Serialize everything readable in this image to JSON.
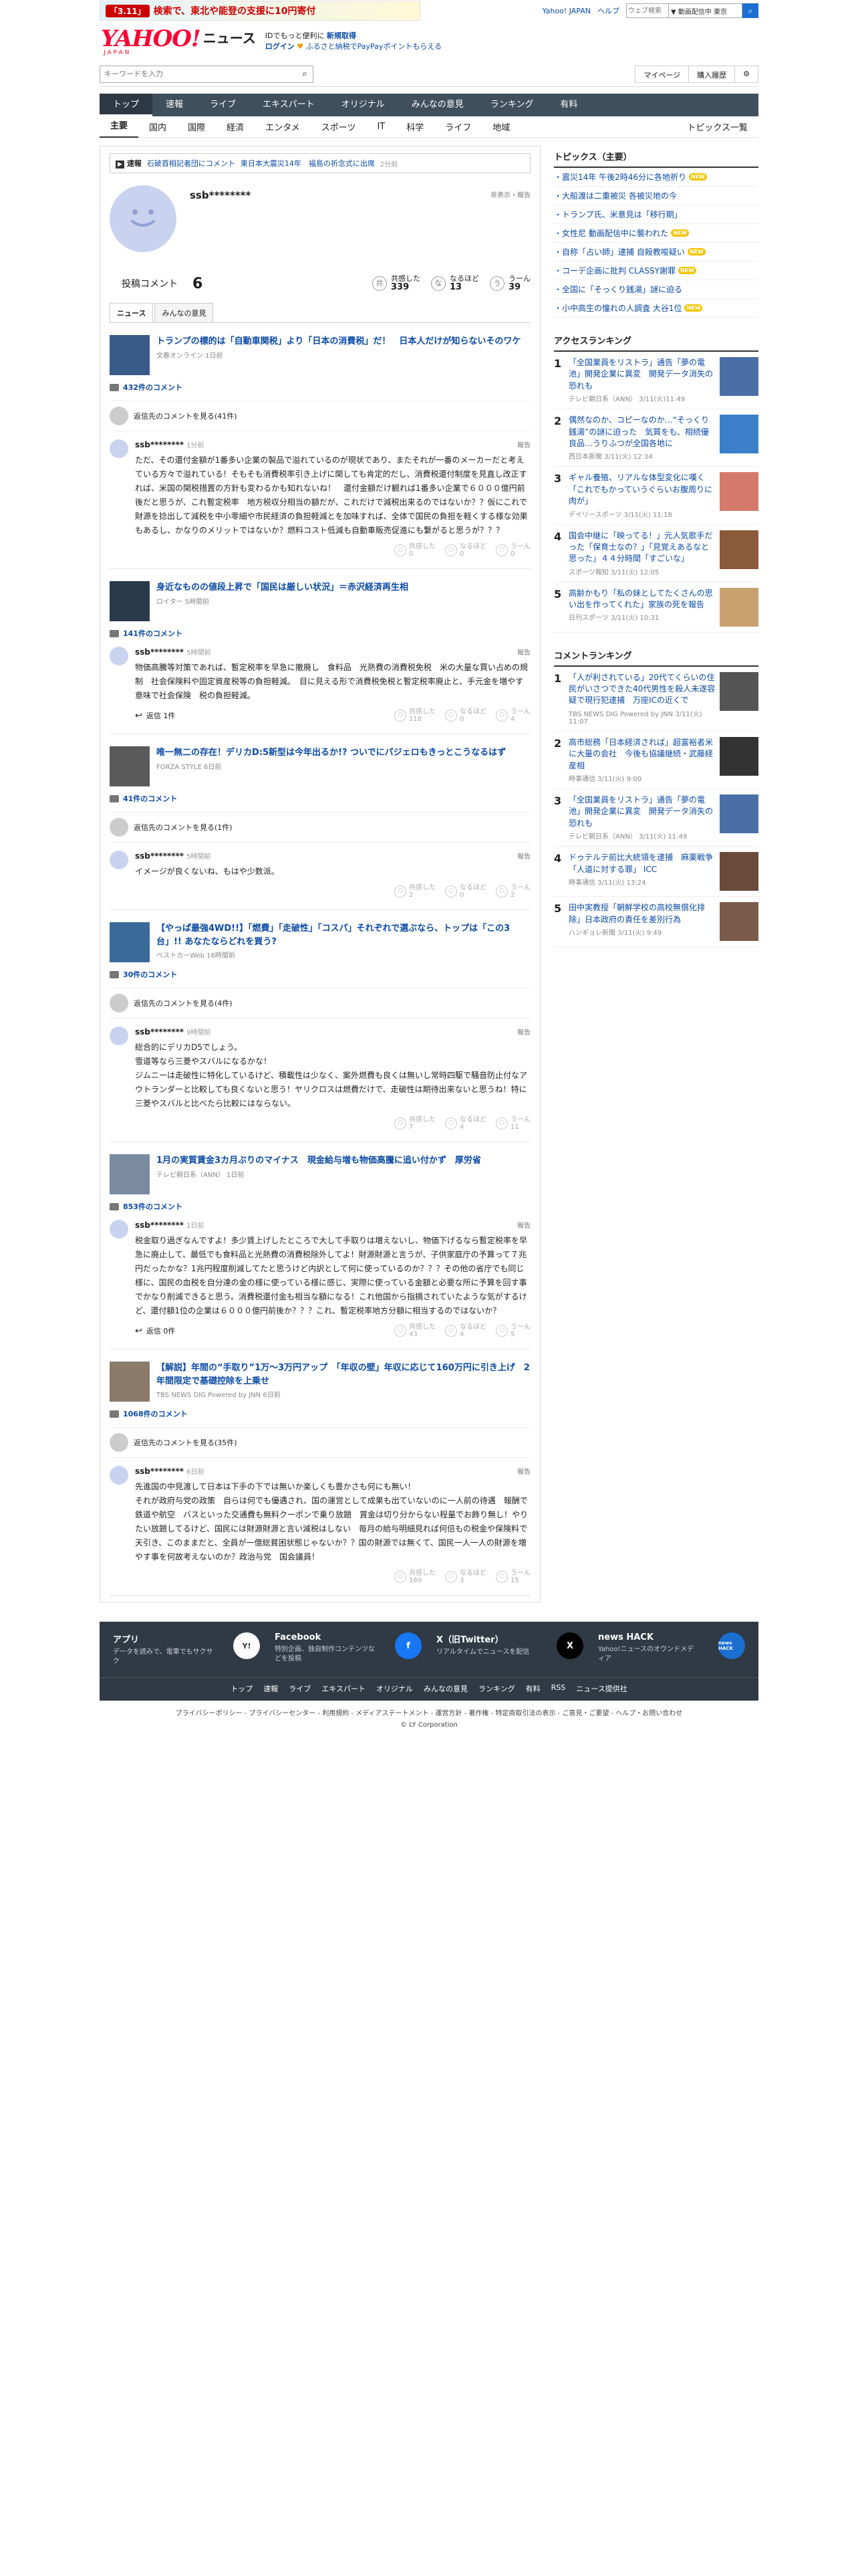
{
  "banner": {
    "badge": "「3.11」",
    "text": "検索で、東北や能登の支援に10円寄付"
  },
  "toplinks": {
    "yahoo": "Yahoo! JAPAN",
    "help": "ヘルプ",
    "search_placeholder": "ウェブ検索",
    "select": "▼ 動画配信中 東京"
  },
  "logo": {
    "main": "YAHOO!",
    "sub": "JAPAN",
    "news": "ニュース"
  },
  "promo": {
    "line1": "IDでもっと便利に",
    "line1b": "新規取得",
    "line2": "ログイン",
    "line2b": "ふるさと納税でPayPayポイントもらえる"
  },
  "search": {
    "placeholder": "キーワードを入力",
    "mypage": "マイページ",
    "history": "購入履歴"
  },
  "navbar": [
    "トップ",
    "速報",
    "ライブ",
    "エキスパート",
    "オリジナル",
    "みんなの意見",
    "ランキング",
    "有料"
  ],
  "subnav": [
    "主要",
    "国内",
    "国際",
    "経済",
    "エンタメ",
    "スポーツ",
    "IT",
    "科学",
    "ライフ",
    "地域"
  ],
  "subnav_right": "トピックス一覧",
  "flash": {
    "label": "速報",
    "t1": "石破首相記者団にコメント",
    "t2": "東日本大震災14年　福島の祈念式に出席",
    "time": "2分前"
  },
  "profile": {
    "name": "ssb********",
    "tools": "非表示・報告",
    "label": "投稿コメント",
    "count": "6"
  },
  "profile_reactions": [
    {
      "icon": "共",
      "label": "共感した",
      "count": "339"
    },
    {
      "icon": "な",
      "label": "なるほど",
      "count": "13"
    },
    {
      "icon": "う",
      "label": "うーん",
      "count": "39"
    }
  ],
  "tabs": [
    "ニュース",
    "みんなの意見"
  ],
  "articles": [
    {
      "title": "トランプの標的は「自動車関税」より「日本の消費税」だ！　日本人だけが知らないそのワケ",
      "source": "文春オンライン 1日前",
      "comments": "432件のコメント",
      "prev": "返信先のコメントを見る(41件)",
      "user": "ssb********",
      "time": "1分前",
      "report": "報告",
      "text": "ただ、その還付金額が1番多い企業の製品で溢れているのが現状であり、またそれが一番のメーカーだと考えている方々で溢れている！そもそも消費税率引き上げに関しても肯定的だし、消費税還付制度を見直し改正すれば、米国の関税措置の方針も変わるかも知れないね！　還付金額だけ観れば1番多い企業で６０００億円前後だと思うが、これ暫定税率　地方税収分相当の額だが、これだけで減税出来るのではないか？？仮にこれで財源を捻出して減税を中小零細や市民経済の負担軽減とを加味すれば、全体で国民の負担を軽くする様な効果もあるし、かなりのメリットではないか？燃料コスト低減も自動車販売促進にも繋がると思うが？？？",
      "reply": "",
      "r": [
        "0",
        "0",
        "0"
      ]
    },
    {
      "title": "身近なものの値段上昇で「国民は厳しい状況」＝赤沢経済再生相",
      "source": "ロイター 5時間前",
      "comments": "141件のコメント",
      "prev": "",
      "user": "ssb********",
      "time": "5時間前",
      "report": "報告",
      "text": "物価高騰等対策であれば、暫定税率を早急に撤廃し　食料品　光熱費の消費税免税　米の大量な買い占めの規制　社会保険料や固定資産税等の負担軽減。　目に見える形で消費税免税と暫定税率廃止と、手元金を増やす意味で社会保険　税の負担軽減。",
      "reply": "返信 1件",
      "r": [
        "118",
        "0",
        "4"
      ]
    },
    {
      "title": "唯一無二の存在！デリカD:5新型は今年出るか!? ついでにパジェロもきっとこうなるはず",
      "source": "FORZA STYLE 6日前",
      "comments": "41件のコメント",
      "prev": "返信先のコメントを見る(1件)",
      "user": "ssb********",
      "time": "5時間前",
      "report": "報告",
      "text": "イメージが良くないね、もはや少数派。",
      "reply": "",
      "r": [
        "2",
        "0",
        "2"
      ]
    },
    {
      "title": "【やっぱ最強4WD!!】「燃費」「走破性」「コスパ」それぞれで選ぶなら、トップは「この3台」!! あなたならどれを買う?",
      "source": "ベストカーWeb 16時間前",
      "comments": "30件のコメント",
      "prev": "返信先のコメントを見る(4件)",
      "user": "ssb********",
      "time": "9時間前",
      "report": "報告",
      "text": "総合的にデリカD5でしょう。\n雪道等なら三菱やスバルになるかな！\nジムニーは走破性に特化しているけど、積載性は少なく、案外燃費も良くは無いし常時四駆で騒音防止付なアウトランダーと比較しても良くないと思う！ヤリクロスは燃費だけで、走破性は期待出来ないと思うね！特に三菱やスバルと比べたら比較にはならない。",
      "reply": "",
      "r": [
        "7",
        "4",
        "11"
      ]
    },
    {
      "title": "1月の実質賃金3カ月ぶりのマイナス　現金給与増も物価高騰に追い付かず　厚労省",
      "source": "テレビ朝日系（ANN） 1日前",
      "comments": "853件のコメント",
      "prev": "",
      "user": "ssb********",
      "time": "1日前",
      "report": "報告",
      "text": "税金取り過ぎなんですよ！多少賃上げしたところで大して手取りは増えないし、物価下げるなら暫定税率を早急に廃止して、最低でも食料品と光熱費の消費税除外してよ！財源財源と言うが、子供家庭庁の予算って７兆円だったかな？1兆円程度削減してたと思うけど内訳として何に使っているのか？？？その他の省庁でも同じ様に、国民の血税を自分達の金の様に使っている様に感じ、実際に使っている金額と必要な所に予算を回す事でかなり削減できると思う。消費税還付金も相当な額になる！これ他国から指摘されていたような気がするけど、還付額1位の企業は６０００億円前後か？？？これ、暫定税率地方分額に相当するのではないか？",
      "reply": "返信 0件",
      "r": [
        "43",
        "4",
        "5"
      ]
    },
    {
      "title": "【解説】年間の“手取り”1万～3万円アップ　「年収の壁」年収に応じて160万円に引き上げ　2年間限定で基礎控除を上乗せ",
      "source": "TBS NEWS DIG Powered by JNN 6日前",
      "comments": "1068件のコメント",
      "prev": "返信先のコメントを見る(35件)",
      "user": "ssb********",
      "time": "6日前",
      "report": "報告",
      "text": "先進国の中見渡して日本は下手の下では無いか楽しくも豊かさも何にも無い！\nそれが政府与党の政策　自らは何でも優遇され、国の運営として成果も出ていないのに一人前の待遇　報酬で　鉄道や航空　バスといった交通費も無料クーポンで乗り放題　賞金は切り分からない程量でお飾り無し！やりたい放題してるけど、国民には財源財源と言い減税はしない　毎月の給与明細見れば何倍もの税金や保険料で天引き、このままだと、全員が一億総貧困状態じゃないか？？国の財源では無くて、国民一人一人の財源を増やす事を何故考えないのか？政治与党　国会議員！",
      "reply": "",
      "r": [
        "169",
        "3",
        "15"
      ]
    }
  ],
  "reaction_labels": [
    "共感した",
    "なるほど",
    "うーん"
  ],
  "side": {
    "topics_title": "トピックス（主要）",
    "topics": [
      {
        "t": "震災14年 午後2時46分に各地祈り",
        "new": true
      },
      {
        "t": "大船渡は二重被災 各被災地の今",
        "new": false
      },
      {
        "t": "トランプ氏、米意見は「移行期」",
        "new": false
      },
      {
        "t": "女性尼 動画配信中に襲われた",
        "new": true
      },
      {
        "t": "自称「占い師」逮捕 自殺教唆疑い",
        "new": true
      },
      {
        "t": "コーデ企画に批判 CLASSY謝罪",
        "new": true
      },
      {
        "t": "全国に「そっくり銭湯」謎に迫る",
        "new": false
      },
      {
        "t": "小中高生の憧れの人調査 大谷1位",
        "new": true
      }
    ],
    "access_title": "アクセスランキング",
    "access": [
      {
        "t": "「全国業員をリストラ」通告「夢の電池」開発企業に異変　開発データ消失の恐れも",
        "s": "テレビ朝日系（ANN） 3/11(火)11:49",
        "c": "#4a6fa5"
      },
      {
        "t": "偶然なのか、コピーなのか…“そっくり銭湯”の謎に迫った　気質をも、相続優良品…うりふつが全国各地に",
        "s": "西日本新聞 3/11(火) 12:34",
        "c": "#3a7fc8"
      },
      {
        "t": "ギャル養殖、リアルな体型変化に嘆く「これでもかっていうぐらいお腹周りに肉が」",
        "s": "デイリースポーツ 3/11(火) 11:18",
        "c": "#d47a6a"
      },
      {
        "t": "国会中継に「映ってる！」元人気歌手だった「保育士なの？」「見覚えあるなと思った」４４分時間「すごいな」",
        "s": "スポーツ報知 3/11(火) 12:05",
        "c": "#8a5a3a"
      },
      {
        "t": "高齢かもり「私の妹としてたくさんの思い出を作ってくれた」家族の死を報告",
        "s": "日刊スポーツ 3/11(火) 10:31",
        "c": "#c9a070"
      }
    ],
    "comment_title": "コメントランキング",
    "commentrank": [
      {
        "t": "「人が利されている」20代てくらいの住民がいさつできた40代男性を殺人未遂容疑で現行犯逮捕　万座ICの近くで",
        "s": "TBS NEWS DIG Powered by JNN 3/11(火) 11:07",
        "c": "#555"
      },
      {
        "t": "高市総務「日本経済されば」超富裕者米に大量の会社　今後も協議継続・武藤経産相",
        "s": "時事通信 3/11(火) 9:00",
        "c": "#333"
      },
      {
        "t": "「全国業員をリストラ」通告「夢の電池」開発企業に異変　開発データ消失の恐れも",
        "s": "テレビ朝日系（ANN） 3/11(火) 11:49",
        "c": "#4a6fa5"
      },
      {
        "t": "ドゥテルテ前比大統領を逮捕　麻薬戦争「人道に対する罪」 ICC",
        "s": "時事通信 3/11(火) 13:24",
        "c": "#6a4a3a"
      },
      {
        "t": "田中実教授「朝鮮学校の高校無償化排除」日本政府の責任を差別行為",
        "s": "ハンギョレ新聞 3/11(火) 9:49",
        "c": "#7a5a4a"
      }
    ]
  },
  "footer": [
    {
      "t": "アプリ",
      "d": "データを読みで、電車でもサクサク",
      "i": "Y!"
    },
    {
      "t": "Facebook",
      "d": "特別企画、独自制作コンテンツなどを投稿",
      "i": "f"
    },
    {
      "t": "X（旧Twitter）",
      "d": "リアルタイムでニュースを配信",
      "i": "X"
    },
    {
      "t": "news HACK",
      "d": "Yahoo!ニュースのオウンドメディア",
      "i": "news HACK"
    }
  ],
  "footer_nav": [
    "トップ",
    "速報",
    "ライブ",
    "エキスパート",
    "オリジナル",
    "みんなの意見",
    "ランキング",
    "有料",
    "RSS",
    "ニュース提供社"
  ],
  "legal": "プライバシーポリシー - プライバシーセンター - 利用規約 - メディアステートメント - 運営方針 - 著作権 - 特定商取引法の表示 - ご意見・ご要望 - ヘルプ・お問い合わせ",
  "copyright": "© LY Corporation"
}
